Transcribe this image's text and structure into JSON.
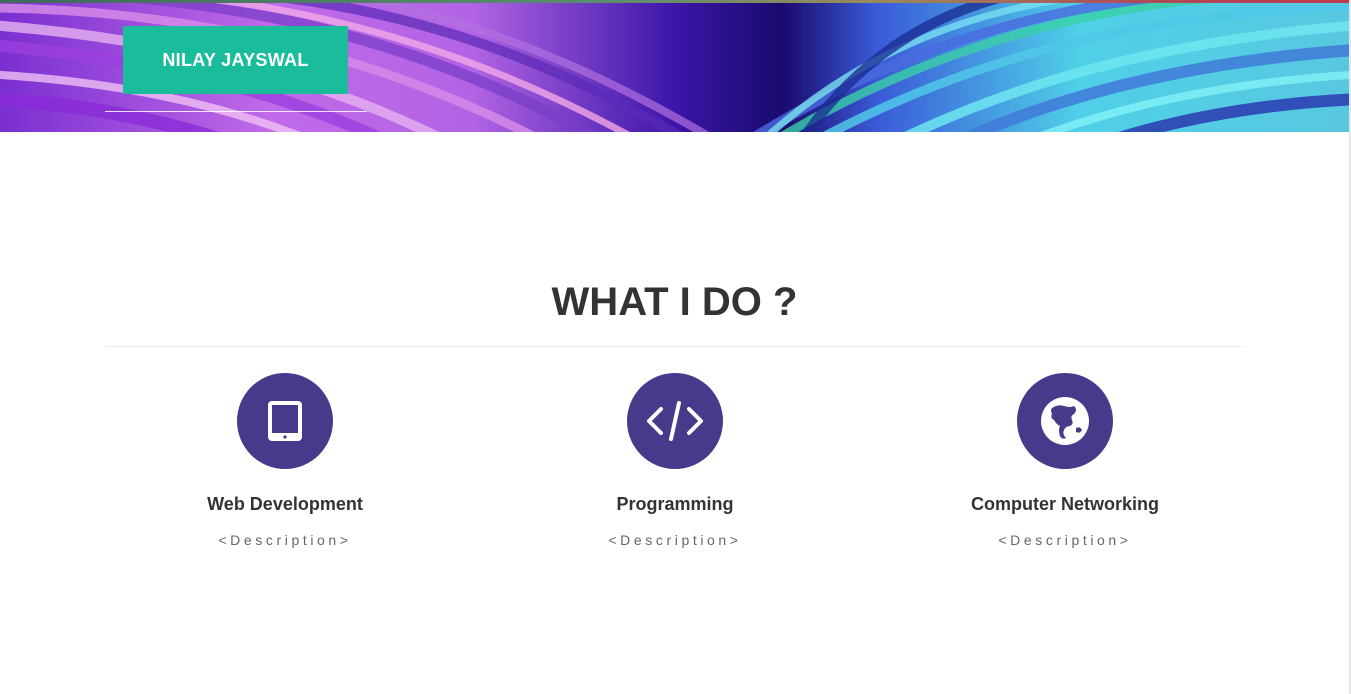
{
  "header": {
    "brand_label": "NILAY JAYSWAL"
  },
  "section": {
    "title": "WHAT I DO ?"
  },
  "services": [
    {
      "title": "Web Development",
      "description": "<Description>",
      "icon": "tablet-icon"
    },
    {
      "title": "Programming",
      "description": "<Description>",
      "icon": "code-icon"
    },
    {
      "title": "Computer Networking",
      "description": "<Description>",
      "icon": "globe-icon"
    }
  ],
  "colors": {
    "brand_button": "#1abc9c",
    "icon_circle": "#483a8b",
    "heading": "#333333",
    "description": "#666666"
  }
}
